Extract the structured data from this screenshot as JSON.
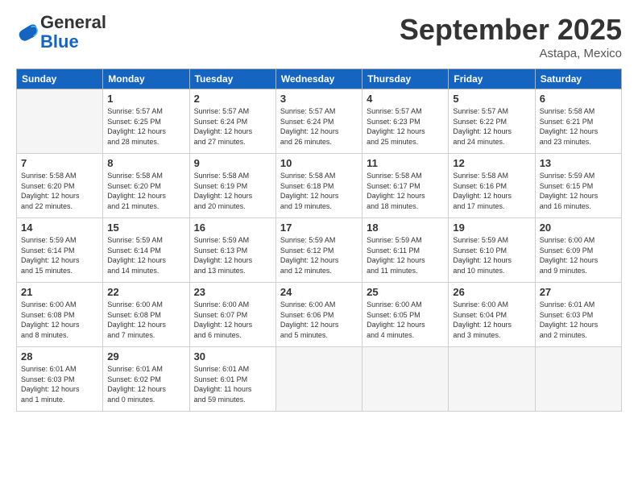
{
  "logo": {
    "general": "General",
    "blue": "Blue"
  },
  "header": {
    "month": "September 2025",
    "location": "Astapa, Mexico"
  },
  "weekdays": [
    "Sunday",
    "Monday",
    "Tuesday",
    "Wednesday",
    "Thursday",
    "Friday",
    "Saturday"
  ],
  "weeks": [
    [
      {
        "day": "",
        "info": ""
      },
      {
        "day": "1",
        "info": "Sunrise: 5:57 AM\nSunset: 6:25 PM\nDaylight: 12 hours\nand 28 minutes."
      },
      {
        "day": "2",
        "info": "Sunrise: 5:57 AM\nSunset: 6:24 PM\nDaylight: 12 hours\nand 27 minutes."
      },
      {
        "day": "3",
        "info": "Sunrise: 5:57 AM\nSunset: 6:24 PM\nDaylight: 12 hours\nand 26 minutes."
      },
      {
        "day": "4",
        "info": "Sunrise: 5:57 AM\nSunset: 6:23 PM\nDaylight: 12 hours\nand 25 minutes."
      },
      {
        "day": "5",
        "info": "Sunrise: 5:57 AM\nSunset: 6:22 PM\nDaylight: 12 hours\nand 24 minutes."
      },
      {
        "day": "6",
        "info": "Sunrise: 5:58 AM\nSunset: 6:21 PM\nDaylight: 12 hours\nand 23 minutes."
      }
    ],
    [
      {
        "day": "7",
        "info": "Sunrise: 5:58 AM\nSunset: 6:20 PM\nDaylight: 12 hours\nand 22 minutes."
      },
      {
        "day": "8",
        "info": "Sunrise: 5:58 AM\nSunset: 6:20 PM\nDaylight: 12 hours\nand 21 minutes."
      },
      {
        "day": "9",
        "info": "Sunrise: 5:58 AM\nSunset: 6:19 PM\nDaylight: 12 hours\nand 20 minutes."
      },
      {
        "day": "10",
        "info": "Sunrise: 5:58 AM\nSunset: 6:18 PM\nDaylight: 12 hours\nand 19 minutes."
      },
      {
        "day": "11",
        "info": "Sunrise: 5:58 AM\nSunset: 6:17 PM\nDaylight: 12 hours\nand 18 minutes."
      },
      {
        "day": "12",
        "info": "Sunrise: 5:58 AM\nSunset: 6:16 PM\nDaylight: 12 hours\nand 17 minutes."
      },
      {
        "day": "13",
        "info": "Sunrise: 5:59 AM\nSunset: 6:15 PM\nDaylight: 12 hours\nand 16 minutes."
      }
    ],
    [
      {
        "day": "14",
        "info": "Sunrise: 5:59 AM\nSunset: 6:14 PM\nDaylight: 12 hours\nand 15 minutes."
      },
      {
        "day": "15",
        "info": "Sunrise: 5:59 AM\nSunset: 6:14 PM\nDaylight: 12 hours\nand 14 minutes."
      },
      {
        "day": "16",
        "info": "Sunrise: 5:59 AM\nSunset: 6:13 PM\nDaylight: 12 hours\nand 13 minutes."
      },
      {
        "day": "17",
        "info": "Sunrise: 5:59 AM\nSunset: 6:12 PM\nDaylight: 12 hours\nand 12 minutes."
      },
      {
        "day": "18",
        "info": "Sunrise: 5:59 AM\nSunset: 6:11 PM\nDaylight: 12 hours\nand 11 minutes."
      },
      {
        "day": "19",
        "info": "Sunrise: 5:59 AM\nSunset: 6:10 PM\nDaylight: 12 hours\nand 10 minutes."
      },
      {
        "day": "20",
        "info": "Sunrise: 6:00 AM\nSunset: 6:09 PM\nDaylight: 12 hours\nand 9 minutes."
      }
    ],
    [
      {
        "day": "21",
        "info": "Sunrise: 6:00 AM\nSunset: 6:08 PM\nDaylight: 12 hours\nand 8 minutes."
      },
      {
        "day": "22",
        "info": "Sunrise: 6:00 AM\nSunset: 6:08 PM\nDaylight: 12 hours\nand 7 minutes."
      },
      {
        "day": "23",
        "info": "Sunrise: 6:00 AM\nSunset: 6:07 PM\nDaylight: 12 hours\nand 6 minutes."
      },
      {
        "day": "24",
        "info": "Sunrise: 6:00 AM\nSunset: 6:06 PM\nDaylight: 12 hours\nand 5 minutes."
      },
      {
        "day": "25",
        "info": "Sunrise: 6:00 AM\nSunset: 6:05 PM\nDaylight: 12 hours\nand 4 minutes."
      },
      {
        "day": "26",
        "info": "Sunrise: 6:00 AM\nSunset: 6:04 PM\nDaylight: 12 hours\nand 3 minutes."
      },
      {
        "day": "27",
        "info": "Sunrise: 6:01 AM\nSunset: 6:03 PM\nDaylight: 12 hours\nand 2 minutes."
      }
    ],
    [
      {
        "day": "28",
        "info": "Sunrise: 6:01 AM\nSunset: 6:03 PM\nDaylight: 12 hours\nand 1 minute."
      },
      {
        "day": "29",
        "info": "Sunrise: 6:01 AM\nSunset: 6:02 PM\nDaylight: 12 hours\nand 0 minutes."
      },
      {
        "day": "30",
        "info": "Sunrise: 6:01 AM\nSunset: 6:01 PM\nDaylight: 11 hours\nand 59 minutes."
      },
      {
        "day": "",
        "info": ""
      },
      {
        "day": "",
        "info": ""
      },
      {
        "day": "",
        "info": ""
      },
      {
        "day": "",
        "info": ""
      }
    ]
  ]
}
